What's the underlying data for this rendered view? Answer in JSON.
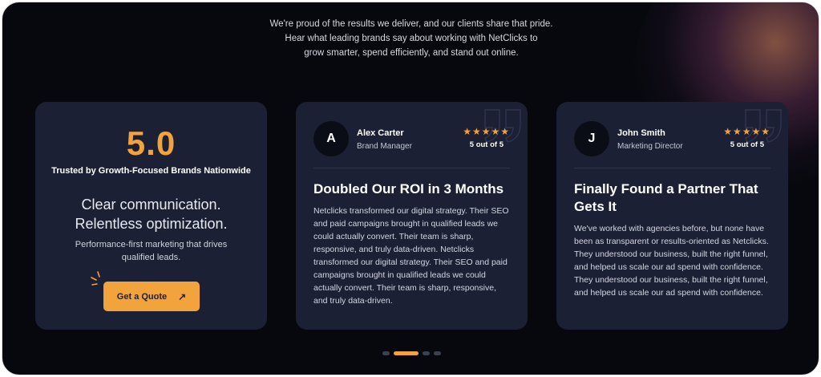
{
  "intro": {
    "line1": "We're proud of the results we deliver, and our clients share that pride.",
    "line2": "Hear what leading brands say about working with NetClicks to",
    "line3": "grow smarter, spend efficiently, and stand out online."
  },
  "rating_card": {
    "score": "5.0",
    "trusted": "Trusted by Growth-Focused Brands Nationwide",
    "headline_line1": "Clear communication.",
    "headline_line2": "Relentless optimization.",
    "sub_line1": "Performance-first marketing that drives",
    "sub_line2": "qualified leads.",
    "cta_label": "Get a Quote",
    "cta_icon": "arrow-up-right-icon"
  },
  "testimonials": [
    {
      "initial": "A",
      "name": "Alex Carter",
      "role": "Brand Manager",
      "stars": "★★★★★",
      "rating_text": "5 out of 5",
      "title": "Doubled Our ROI in 3 Months",
      "body": "Netclicks transformed our digital strategy. Their SEO and paid campaigns brought in qualified leads we could actually convert. Their team is sharp, responsive, and truly data-driven. Netclicks transformed our digital strategy. Their SEO and paid campaigns brought in qualified leads we could actually convert. Their team is sharp, responsive, and truly data-driven."
    },
    {
      "initial": "J",
      "name": "John Smith",
      "role": "Marketing Director",
      "stars": "★★★★★",
      "rating_text": "5 out of 5",
      "title": "Finally Found a Partner That Gets It",
      "body": "We've worked with agencies before, but none have been as transparent or results-oriented as Netclicks. They understood our business, built the right funnel, and helped us scale our ad spend with confidence. They understood our business, built the right funnel, and helped us scale our ad spend with confidence."
    }
  ],
  "pagination": {
    "count": 4,
    "active_index": 1
  },
  "colors": {
    "background": "#07080d",
    "card": "#1b2035",
    "accent": "#f3a33c",
    "text": "#ffffff"
  }
}
